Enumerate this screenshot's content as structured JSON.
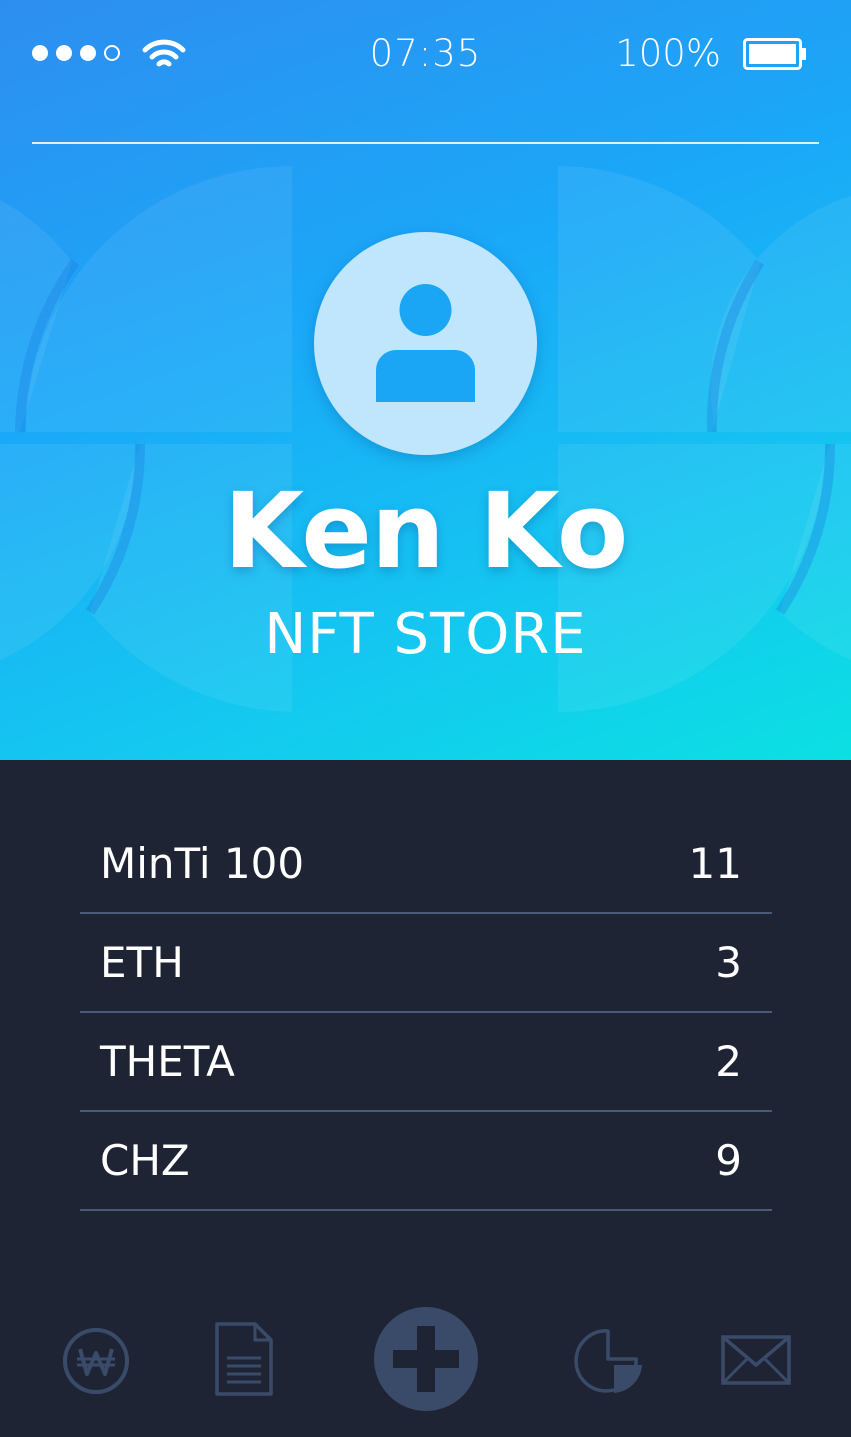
{
  "status_bar": {
    "time": "07:35",
    "battery_percent": "100%",
    "signal_bars_filled": 3,
    "signal_bars_total": 4
  },
  "profile": {
    "name": "Ken Ko",
    "subtitle": "NFT STORE",
    "avatar_icon": "user-icon"
  },
  "holdings": [
    {
      "label": "MinTi 100",
      "value": "11"
    },
    {
      "label": "ETH",
      "value": "3"
    },
    {
      "label": "THETA",
      "value": "2"
    },
    {
      "label": "CHZ",
      "value": "9"
    }
  ],
  "tab_bar": {
    "items": [
      {
        "icon": "won-coin-icon"
      },
      {
        "icon": "document-icon"
      },
      {
        "icon": "plus-icon"
      },
      {
        "icon": "pie-chart-icon"
      },
      {
        "icon": "mail-icon"
      }
    ]
  },
  "colors": {
    "header_gradient_start": "#2e8ef0",
    "header_gradient_end": "#0be0e2",
    "body_background": "#1e2434",
    "tab_icon": "#3a4b6a",
    "row_divider": "#4a5a78"
  }
}
